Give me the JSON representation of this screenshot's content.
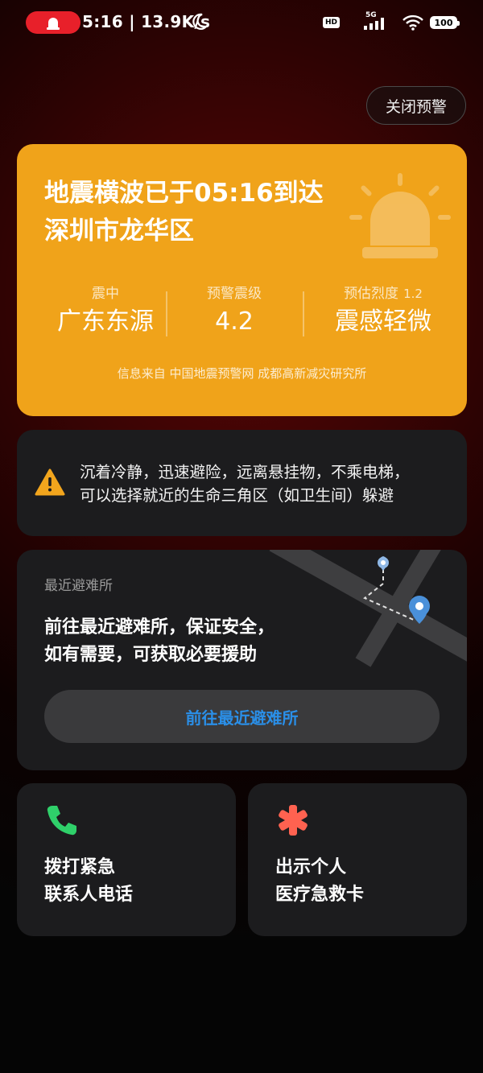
{
  "status_bar": {
    "time_speed": "5:16 | 13.9K/s",
    "hd": "HD",
    "network": "5G",
    "battery": "100"
  },
  "header": {
    "close_label": "关闭预警"
  },
  "warning": {
    "headline_line1": "地震横波已于05:16到达",
    "headline_line2": "深圳市龙华区",
    "epicenter_label": "震中",
    "epicenter_value": "广东东源",
    "magnitude_label": "预警震级",
    "magnitude_value": "4.2",
    "intensity_label": "预估烈度",
    "intensity_number": "1.2",
    "intensity_value": "震感轻微",
    "source": "信息来自 中国地震预警网 成都高新减灾研究所"
  },
  "advice": {
    "line1": "沉着冷静，迅速避险，远离悬挂物，不乘电梯，",
    "line2": "可以选择就近的生命三角区（如卫生间）躲避"
  },
  "shelter": {
    "label": "最近避难所",
    "line1": "前往最近避难所，保证安全，",
    "line2": "如有需要，可获取必要援助",
    "button": "前往最近避难所"
  },
  "actions": {
    "call_line1": "拨打紧急",
    "call_line2": "联系人电话",
    "medical_line1": "出示个人",
    "medical_line2": "医疗急救卡"
  },
  "colors": {
    "card_orange": "#f0a31a",
    "accent_blue": "#2a8fe8",
    "phone_green": "#2fd06a",
    "medical_red": "#ff6250",
    "alert_red": "#e8202a"
  }
}
